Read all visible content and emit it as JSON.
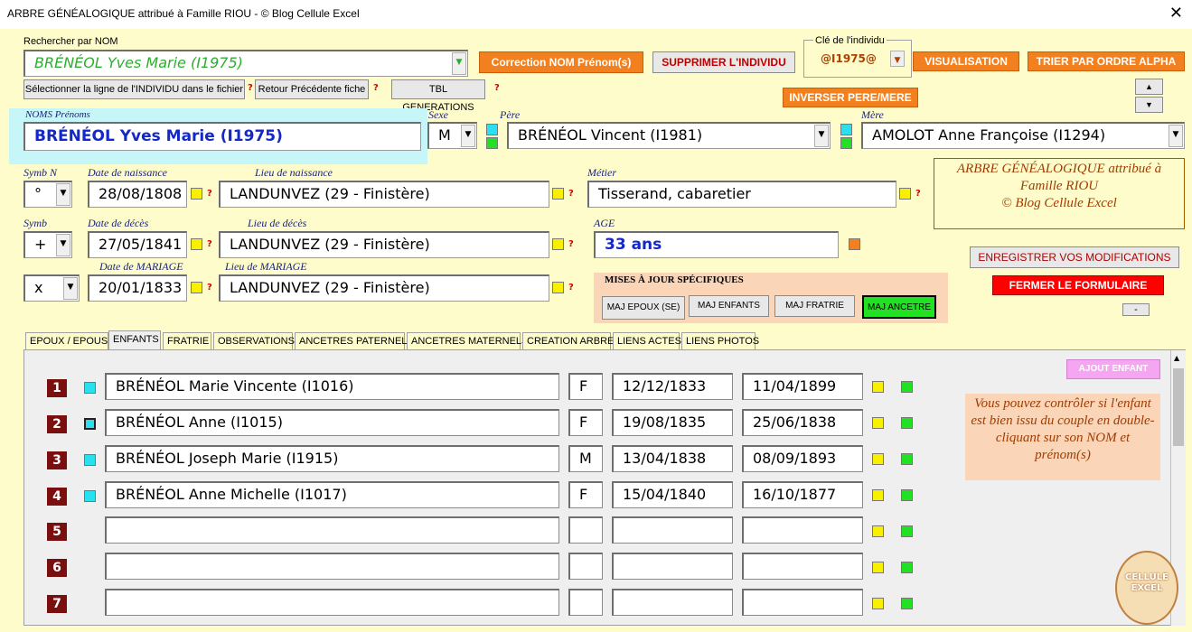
{
  "window": {
    "title": "ARBRE GÉNÉALOGIQUE attribué à Famille RIOU - © Blog Cellule Excel",
    "close_glyph": "✕"
  },
  "search": {
    "label": "Rechercher par NOM",
    "value": "BRÉNÉOL Yves Marie (I1975)"
  },
  "buttons": {
    "correction": "Correction NOM Prénom(s)",
    "supprimer": "SUPPRIMER L'INDIVIDU",
    "visualisation": "VISUALISATION",
    "trier": "TRIER PAR ORDRE ALPHA",
    "select_line": "Sélectionner la ligne de l'INDIVIDU  dans le fichier",
    "retour": "Retour Précédente fiche",
    "tbl_gen": "TBL GENERATIONS",
    "inverser": "INVERSER PERE/MERE",
    "enregistrer": "ENREGISTRER VOS MODIFICATIONS",
    "fermer": "FERMER LE FORMULAIRE",
    "minus": "-",
    "maj_epoux": "MAJ EPOUX (SE)",
    "maj_enfants": "MAJ ENFANTS",
    "maj_fratrie": "MAJ FRATRIE",
    "maj_ancetre": "MAJ ANCETRE",
    "ajout_enfant": "AJOUT ENFANT"
  },
  "key": {
    "label": "Clé de l'individu",
    "value": "@I1975@"
  },
  "qmark": "?",
  "person": {
    "names_label": "NOMS Prénoms",
    "name": "BRÉNÉOL Yves Marie (I1975)",
    "sexe_label": "Sexe",
    "sexe": "M",
    "pere_label": "Père",
    "pere": "BRÉNÉOL Vincent (I1981)",
    "mere_label": "Mère",
    "mere": "AMOLOT Anne Françoise (I1294)",
    "symbn_label": "Symb N",
    "symbn": "°",
    "naissance_label": "Date de naissance",
    "naissance": "28/08/1808",
    "lieu_naissance_label": "Lieu de naissance",
    "lieu_naissance": "LANDUNVEZ (29 - Finistère)",
    "metier_label": "Métier",
    "metier": "Tisserand, cabaretier",
    "symb_label": "Symb",
    "symb": "+",
    "deces_label": "Date de décès",
    "deces": "27/05/1841",
    "lieu_deces_label": "Lieu de décès",
    "lieu_deces": "LANDUNVEZ (29 - Finistère)",
    "age_label": "AGE",
    "age": "33 ans",
    "symbm": "x",
    "mariage_label": "Date de MARIAGE",
    "mariage": "20/01/1833",
    "lieu_mariage_label": "Lieu de MARIAGE",
    "lieu_mariage": "LANDUNVEZ (29 - Finistère)"
  },
  "info_box": {
    "line1": "ARBRE GÉNÉALOGIQUE attribué à",
    "line2": "Famille RIOU",
    "line3": "© Blog Cellule Excel"
  },
  "maj_title": "MISES À JOUR SPÉCIFIQUES",
  "tabs": [
    "EPOUX / EPOUSE",
    "ENFANTS",
    "FRATRIE",
    "OBSERVATIONS",
    "ANCETRES PATERNELS",
    "ANCETRES MATERNELS",
    "CREATION ARBRE",
    "LIENS ACTES",
    "LIENS PHOTOS"
  ],
  "children": [
    {
      "num": "1",
      "name": "BRÉNÉOL Marie Vincente (I1016)",
      "sex": "F",
      "birth": "12/12/1833",
      "death": "11/04/1899"
    },
    {
      "num": "2",
      "name": "BRÉNÉOL Anne (I1015)",
      "sex": "F",
      "birth": "19/08/1835",
      "death": "25/06/1838"
    },
    {
      "num": "3",
      "name": "BRÉNÉOL Joseph Marie (I1915)",
      "sex": "M",
      "birth": "13/04/1838",
      "death": "08/09/1893"
    },
    {
      "num": "4",
      "name": "BRÉNÉOL Anne Michelle (I1017)",
      "sex": "F",
      "birth": "15/04/1840",
      "death": "16/10/1877"
    },
    {
      "num": "5",
      "name": "",
      "sex": "",
      "birth": "",
      "death": ""
    },
    {
      "num": "6",
      "name": "",
      "sex": "",
      "birth": "",
      "death": ""
    },
    {
      "num": "7",
      "name": "",
      "sex": "",
      "birth": "",
      "death": ""
    }
  ],
  "note": "Vous pouvez contrôler si l'enfant est  bien issu du couple en double-cliquant sur son NOM et prénom(s)",
  "logo_text": "CELLULE EXCEL"
}
